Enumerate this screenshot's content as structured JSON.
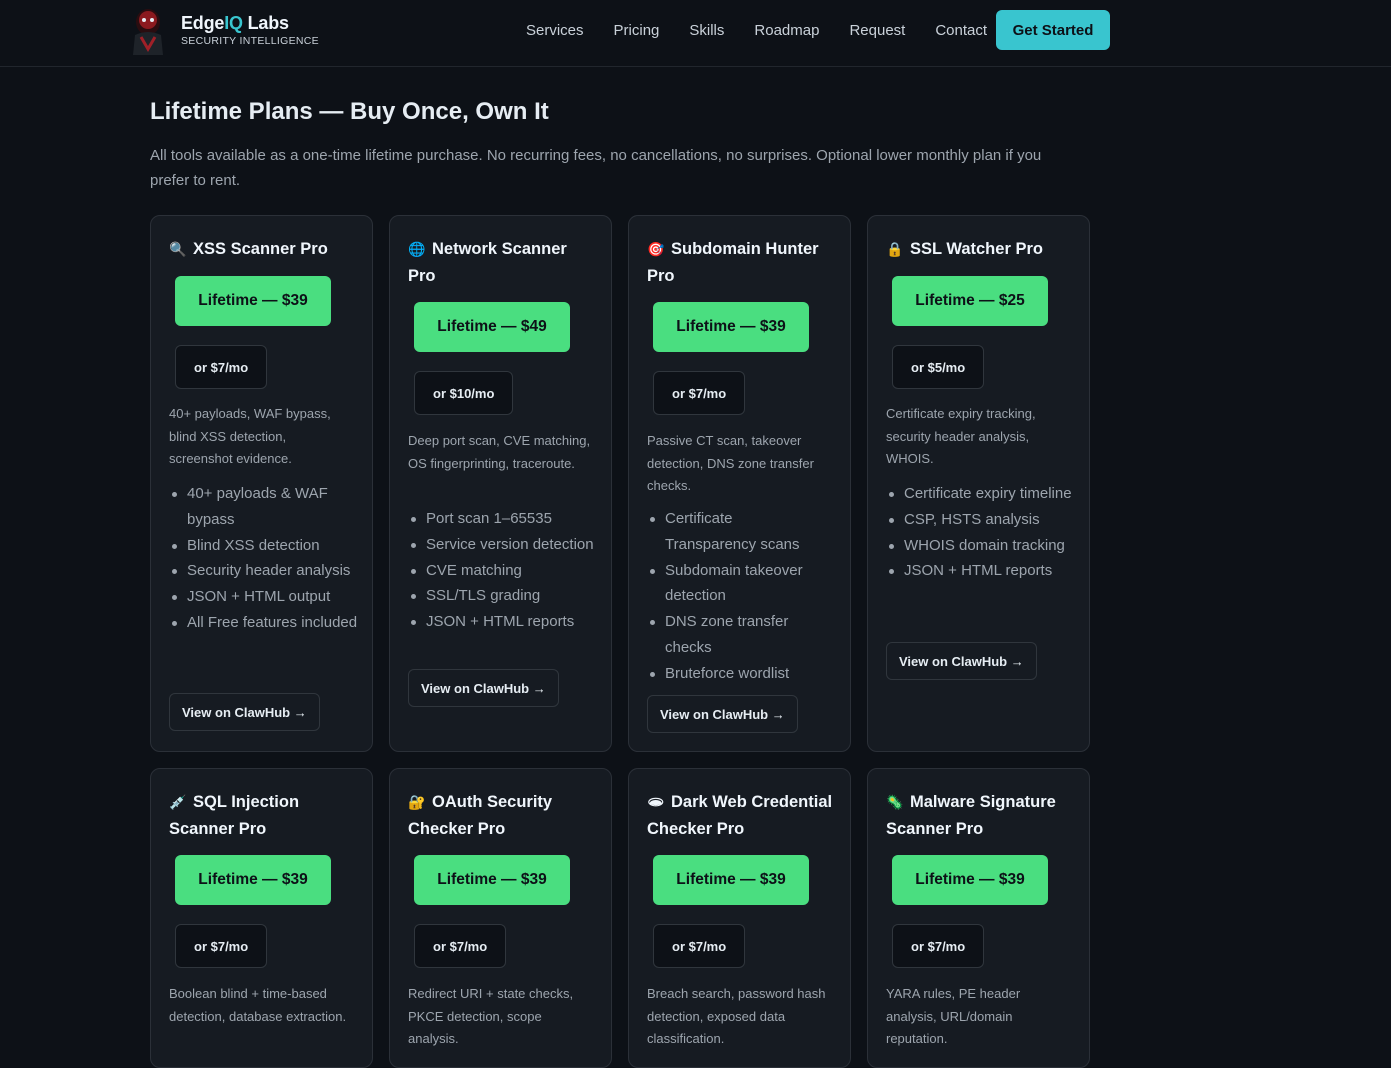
{
  "header": {
    "brand_main": "EdgeIQ",
    "brand_accent": "IQ",
    "brand_suffix": "Labs",
    "tagline": "SECURITY INTELLIGENCE",
    "nav": [
      "Services",
      "Pricing",
      "Skills",
      "Roadmap",
      "Request",
      "Contact"
    ],
    "cta_label": "Get Started",
    "accent_color": "#39c5cf"
  },
  "hero": {
    "title": "Lifetime Plans — Buy Once, Own It",
    "description": "All tools available as a one-time lifetime purchase. No recurring fees, no cancellations, no surprises. Optional lower monthly plan if you prefer to rent."
  },
  "cards": [
    {
      "icon": "magnifier-icon",
      "icon_glyph": "🔍",
      "title": "XSS Scanner Pro",
      "lifetime": "Lifetime — $39",
      "monthly": "or $7/mo",
      "desc": "40+ payloads, WAF bypass, blind XSS detection, screenshot evidence.",
      "features": [
        "40+ payloads & WAF bypass",
        "Blind XSS detection",
        "Security header analysis",
        "JSON + HTML output",
        "All Free features included"
      ],
      "link": "View on ClawHub →"
    },
    {
      "icon": "globe-icon",
      "icon_glyph": "🌐",
      "title": "Network Scanner Pro",
      "lifetime": "Lifetime — $49",
      "monthly": "or $10/mo",
      "desc": "Deep port scan, CVE matching, OS fingerprinting, traceroute.",
      "features": [
        "Port scan 1–65535",
        "Service version detection",
        "CVE matching",
        "SSL/TLS grading",
        "JSON + HTML reports"
      ],
      "link": "View on ClawHub →"
    },
    {
      "icon": "target-icon",
      "icon_glyph": "🎯",
      "title": "Subdomain Hunter Pro",
      "lifetime": "Lifetime — $39",
      "monthly": "or $7/mo",
      "desc": "Passive CT scan, takeover detection, DNS zone transfer checks.",
      "features": [
        "Certificate Transparency scans",
        "Subdomain takeover detection",
        "DNS zone transfer checks",
        "Bruteforce wordlist"
      ],
      "link": "View on ClawHub →"
    },
    {
      "icon": "lock-icon",
      "icon_glyph": "🔒",
      "title": "SSL Watcher Pro",
      "lifetime": "Lifetime — $25",
      "monthly": "or $5/mo",
      "desc": "Certificate expiry tracking, security header analysis, WHOIS.",
      "features": [
        "Certificate expiry timeline",
        "CSP, HSTS analysis",
        "WHOIS domain tracking",
        "JSON + HTML reports"
      ],
      "link": "View on ClawHub →"
    },
    {
      "icon": "syringe-icon",
      "icon_glyph": "💉",
      "title": "SQL Injection Scanner Pro",
      "lifetime": "Lifetime — $39",
      "monthly": "or $7/mo",
      "desc": "Boolean blind + time-based detection, database extraction."
    },
    {
      "icon": "key-lock-icon",
      "icon_glyph": "🔐",
      "title": "OAuth Security Checker Pro",
      "lifetime": "Lifetime — $39",
      "monthly": "or $7/mo",
      "desc": "Redirect URI + state checks, PKCE detection, scope analysis."
    },
    {
      "icon": "dark-web-icon",
      "icon_glyph": "🕳",
      "title": "Dark Web Credential Checker Pro",
      "lifetime": "Lifetime — $39",
      "monthly": "or $7/mo",
      "desc": "Breach search, password hash detection, exposed data classification."
    },
    {
      "icon": "bug-icon",
      "icon_glyph": "🦠",
      "title": "Malware Signature Scanner Pro",
      "lifetime": "Lifetime — $39",
      "monthly": "or $7/mo",
      "desc": "YARA rules, PE header analysis, URL/domain reputation."
    }
  ]
}
